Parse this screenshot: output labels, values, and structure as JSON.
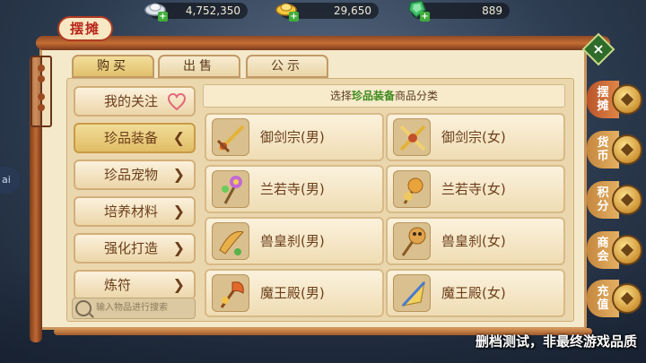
{
  "currencies": [
    {
      "icon": "silver-ingot-icon",
      "value": "4,752,350"
    },
    {
      "icon": "gold-ingot-icon",
      "value": "29,650"
    },
    {
      "icon": "jade-gem-icon",
      "value": "889"
    }
  ],
  "panel": {
    "title": "摆摊",
    "tabs": [
      {
        "label": "购买",
        "active": true
      },
      {
        "label": "出售",
        "active": false
      },
      {
        "label": "公示",
        "active": false
      }
    ]
  },
  "categories": [
    {
      "label": "我的关注",
      "icon": "heart-icon"
    },
    {
      "label": "珍品装备",
      "arrow": "❮",
      "active": true
    },
    {
      "label": "珍品宠物",
      "arrow": "❯"
    },
    {
      "label": "培养材料",
      "arrow": "❯"
    },
    {
      "label": "强化打造",
      "arrow": "❯"
    },
    {
      "label": "炼符",
      "arrow": "❯"
    }
  ],
  "search": {
    "placeholder": "输入物品进行搜索"
  },
  "header": {
    "prefix": "选择",
    "highlight": "珍品装备",
    "suffix": "商品分类"
  },
  "items": [
    {
      "label": "御剑宗(男)",
      "icon": "sword-icon"
    },
    {
      "label": "御剑宗(女)",
      "icon": "crossed-swords-icon"
    },
    {
      "label": "兰若寺(男)",
      "icon": "flower-staff-icon"
    },
    {
      "label": "兰若寺(女)",
      "icon": "lantern-staff-icon"
    },
    {
      "label": "兽皇刹(男)",
      "icon": "beast-blade-icon"
    },
    {
      "label": "兽皇刹(女)",
      "icon": "beast-mace-icon"
    },
    {
      "label": "魔王殿(男)",
      "icon": "demon-axe-icon"
    },
    {
      "label": "魔王殿(女)",
      "icon": "demon-fan-icon"
    }
  ],
  "side_tabs": [
    {
      "label": "摆摊",
      "active": true
    },
    {
      "label": "货币",
      "active": false
    },
    {
      "label": "积分",
      "active": false
    },
    {
      "label": "商会",
      "active": false
    },
    {
      "label": "充值",
      "active": false
    }
  ],
  "side_bubble": "ai",
  "watermark": "删档测试，非最终游戏品质"
}
